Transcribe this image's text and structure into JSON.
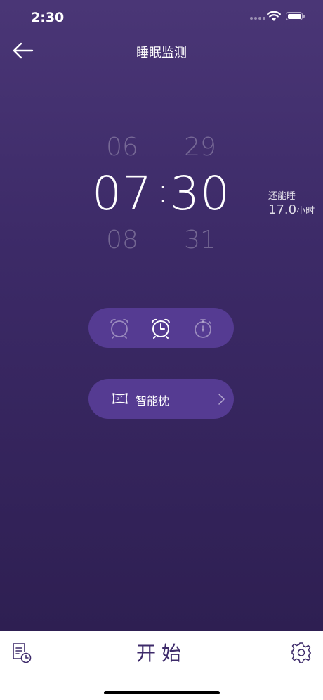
{
  "status_bar": {
    "time": "2:30",
    "icons": [
      "signal-icon",
      "wifi-icon",
      "battery-icon"
    ]
  },
  "nav": {
    "title": "睡眠监测",
    "back_icon": "arrow-left-icon"
  },
  "picker": {
    "hour_prev": "06",
    "hour": "07",
    "hour_next": "08",
    "minute_prev": "29",
    "minute": "30",
    "minute_next": "31",
    "separator": ":"
  },
  "remaining": {
    "label": "还能睡",
    "value": "17.0",
    "unit": "小时"
  },
  "modes": [
    {
      "icon": "alarm-clock-icon",
      "selected": false
    },
    {
      "icon": "alarm-clock-time-icon",
      "selected": true
    },
    {
      "icon": "stopwatch-icon",
      "selected": false
    }
  ],
  "pillow": {
    "label": "智能枕",
    "icon": "smart-pillow-icon"
  },
  "bottom": {
    "start_label": "开始",
    "history_icon": "history-icon",
    "settings_icon": "gear-icon"
  },
  "colors": {
    "background_top": "#4a3676",
    "background_bottom": "#2e1f52",
    "pill": "#553b92",
    "start_text": "#3d2a6a"
  }
}
